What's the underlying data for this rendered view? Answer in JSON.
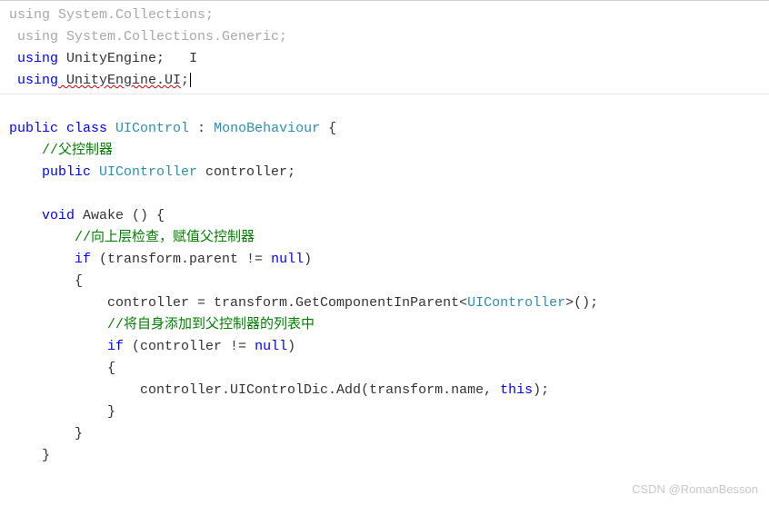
{
  "code": {
    "using1_kw": "using",
    "using1_ns": " System.Collections;",
    "using2_kw": " using",
    "using2_ns": " System.Collections.Generic;",
    "using3_kw": " using",
    "using3_ns": " UnityEngine;",
    "using4_kw": " using",
    "using4_ns": " UnityEngine.UI",
    "using4_semi": ";",
    "class_public": "public",
    "class_class": " class",
    "class_name": " UIControl",
    "class_colon": " : ",
    "class_base": "MonoBehaviour",
    "class_brace": " {",
    "comment1": "    //父控制器",
    "field_public": "    public",
    "field_type": " UIController",
    "field_name": " controller;",
    "awake_void": "    void",
    "awake_name": " Awake",
    "awake_paren": " () {",
    "comment2": "        //向上层检查，赋值父控制器",
    "if1_if": "        if",
    "if1_open": " (transform.parent != ",
    "if1_null": "null",
    "if1_close": ")",
    "if1_brace_open": "        {",
    "assign_line": "            controller = transform.GetComponentInParent<",
    "assign_type": "UIController",
    "assign_end": ">();",
    "comment3": "            //将自身添加到父控制器的列表中",
    "if2_if": "            if",
    "if2_open": " (controller != ",
    "if2_null": "null",
    "if2_close": ")",
    "if2_brace_open": "            {",
    "add_line": "                controller.UIControlDic.Add(transform.name, ",
    "add_this": "this",
    "add_end": ");",
    "if2_brace_close": "            }",
    "if1_brace_close": "        }",
    "awake_brace_close": "    }",
    "cursor_marker": "I"
  },
  "watermark": "CSDN @RomanBesson"
}
